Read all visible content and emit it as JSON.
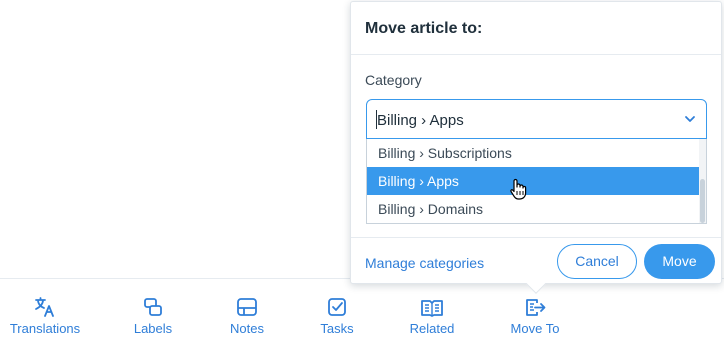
{
  "popover": {
    "title": "Move article to:",
    "field_label": "Category",
    "select_value": "Billing › Apps",
    "options": [
      {
        "label": "Billing › Subscriptions",
        "selected": false
      },
      {
        "label": "Billing › Apps",
        "selected": true
      },
      {
        "label": "Billing › Domains",
        "selected": false
      }
    ],
    "manage_link": "Manage categories",
    "cancel_label": "Cancel",
    "move_label": "Move"
  },
  "toolbar": {
    "items": [
      {
        "label": "Translations",
        "icon": "translate-icon"
      },
      {
        "label": "Labels",
        "icon": "labels-icon"
      },
      {
        "label": "Notes",
        "icon": "notes-icon"
      },
      {
        "label": "Tasks",
        "icon": "tasks-icon"
      },
      {
        "label": "Related",
        "icon": "related-icon"
      },
      {
        "label": "Move To",
        "icon": "move-to-icon"
      }
    ]
  },
  "colors": {
    "accent": "#3899ec",
    "link": "#2f7ed8",
    "text_dark": "#20303c"
  }
}
